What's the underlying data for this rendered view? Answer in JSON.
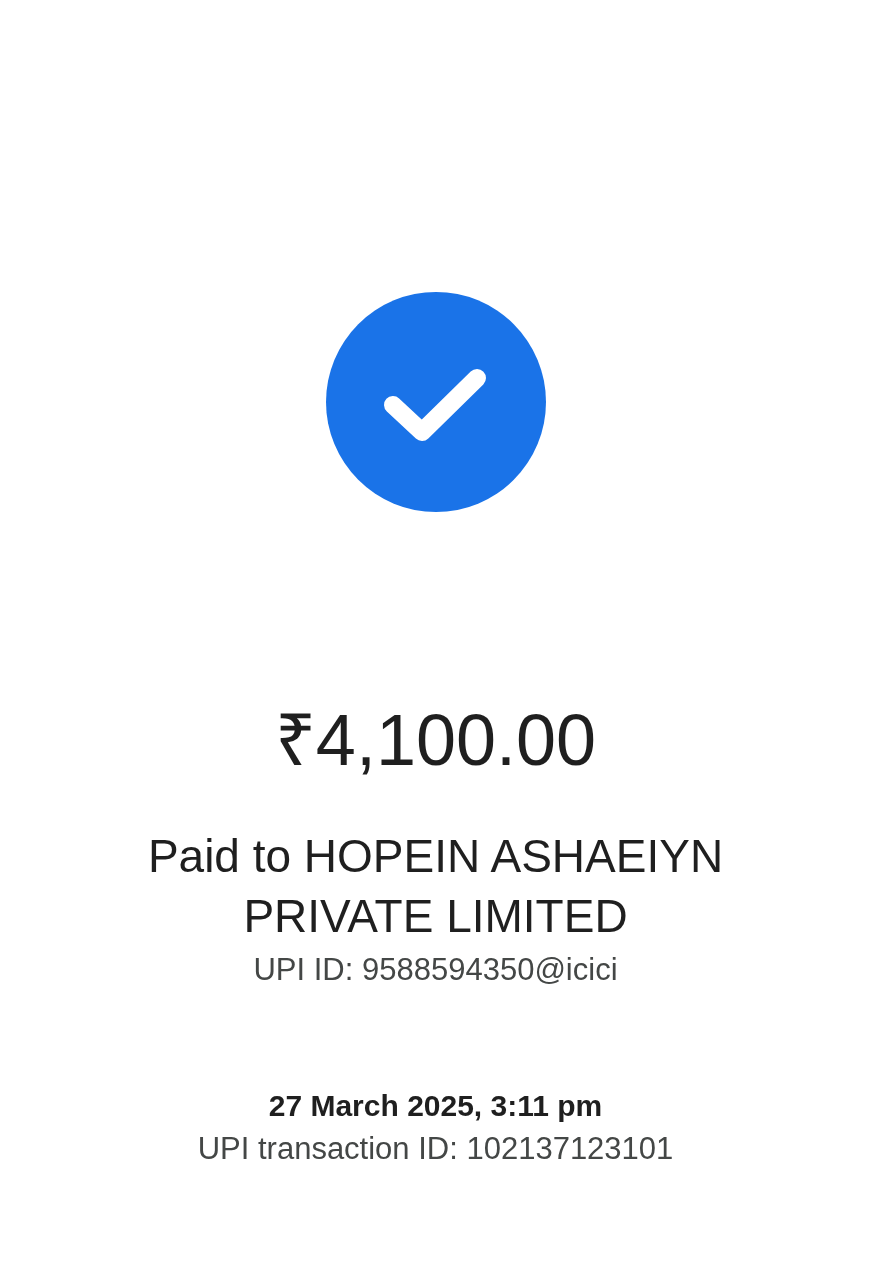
{
  "amount": "₹4,100.00",
  "payee": {
    "label": "Paid to HOPEIN ASHAEIYN PRIVATE LIMITED",
    "upi_id": "UPI ID: 9588594350@icici"
  },
  "date_time": "27 March 2025, 3:11 pm",
  "transaction_id": "UPI transaction ID: 102137123101"
}
